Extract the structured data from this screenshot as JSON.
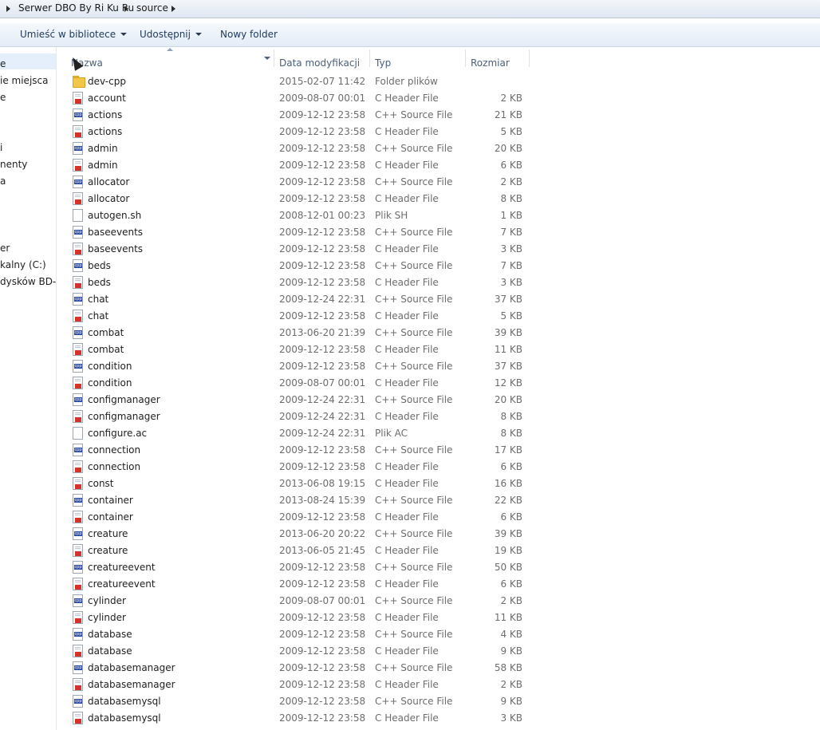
{
  "address": {
    "crumbs": [
      "Serwer DBO By Ri Ku Ru",
      "source"
    ]
  },
  "toolbar": {
    "include_in_library": "Umieść w bibliotece",
    "share": "Udostępnij",
    "new_folder": "Nowy folder"
  },
  "nav": {
    "items": [
      "e",
      "ie miejsca",
      "e",
      "i",
      "nenty",
      "a",
      "er",
      "kalny (C:)",
      "dysków BD-R("
    ]
  },
  "columns": {
    "name": "Nazwa",
    "date": "Data modyfikacji",
    "type": "Typ",
    "size": "Rozmiar"
  },
  "files": [
    {
      "name": "dev-cpp",
      "date": "2015-02-07 11:42",
      "type": "Folder plików",
      "size": "",
      "icon": "folder-icon"
    },
    {
      "name": "account",
      "date": "2009-08-07 00:01",
      "type": "C Header File",
      "size": "2 KB",
      "icon": "c-header-file-icon"
    },
    {
      "name": "actions",
      "date": "2009-12-12 23:58",
      "type": "C++ Source File",
      "size": "21 KB",
      "icon": "cpp-source-file-icon"
    },
    {
      "name": "actions",
      "date": "2009-12-12 23:58",
      "type": "C Header File",
      "size": "5 KB",
      "icon": "c-header-file-icon"
    },
    {
      "name": "admin",
      "date": "2009-12-12 23:58",
      "type": "C++ Source File",
      "size": "20 KB",
      "icon": "cpp-source-file-icon"
    },
    {
      "name": "admin",
      "date": "2009-12-12 23:58",
      "type": "C Header File",
      "size": "6 KB",
      "icon": "c-header-file-icon"
    },
    {
      "name": "allocator",
      "date": "2009-12-12 23:58",
      "type": "C++ Source File",
      "size": "2 KB",
      "icon": "cpp-source-file-icon"
    },
    {
      "name": "allocator",
      "date": "2009-12-12 23:58",
      "type": "C Header File",
      "size": "8 KB",
      "icon": "c-header-file-icon"
    },
    {
      "name": "autogen.sh",
      "date": "2008-12-01 00:23",
      "type": "Plik SH",
      "size": "1 KB",
      "icon": "generic-file-icon"
    },
    {
      "name": "baseevents",
      "date": "2009-12-12 23:58",
      "type": "C++ Source File",
      "size": "7 KB",
      "icon": "cpp-source-file-icon"
    },
    {
      "name": "baseevents",
      "date": "2009-12-12 23:58",
      "type": "C Header File",
      "size": "3 KB",
      "icon": "c-header-file-icon"
    },
    {
      "name": "beds",
      "date": "2009-12-12 23:58",
      "type": "C++ Source File",
      "size": "7 KB",
      "icon": "cpp-source-file-icon"
    },
    {
      "name": "beds",
      "date": "2009-12-12 23:58",
      "type": "C Header File",
      "size": "3 KB",
      "icon": "c-header-file-icon"
    },
    {
      "name": "chat",
      "date": "2009-12-24 22:31",
      "type": "C++ Source File",
      "size": "37 KB",
      "icon": "cpp-source-file-icon"
    },
    {
      "name": "chat",
      "date": "2009-12-12 23:58",
      "type": "C Header File",
      "size": "5 KB",
      "icon": "c-header-file-icon"
    },
    {
      "name": "combat",
      "date": "2013-06-20 21:39",
      "type": "C++ Source File",
      "size": "39 KB",
      "icon": "cpp-source-file-icon"
    },
    {
      "name": "combat",
      "date": "2009-12-12 23:58",
      "type": "C Header File",
      "size": "11 KB",
      "icon": "c-header-file-icon"
    },
    {
      "name": "condition",
      "date": "2009-12-12 23:58",
      "type": "C++ Source File",
      "size": "37 KB",
      "icon": "cpp-source-file-icon"
    },
    {
      "name": "condition",
      "date": "2009-08-07 00:01",
      "type": "C Header File",
      "size": "12 KB",
      "icon": "c-header-file-icon"
    },
    {
      "name": "configmanager",
      "date": "2009-12-24 22:31",
      "type": "C++ Source File",
      "size": "20 KB",
      "icon": "cpp-source-file-icon"
    },
    {
      "name": "configmanager",
      "date": "2009-12-24 22:31",
      "type": "C Header File",
      "size": "8 KB",
      "icon": "c-header-file-icon"
    },
    {
      "name": "configure.ac",
      "date": "2009-12-24 22:31",
      "type": "Plik AC",
      "size": "8 KB",
      "icon": "generic-file-icon"
    },
    {
      "name": "connection",
      "date": "2009-12-12 23:58",
      "type": "C++ Source File",
      "size": "17 KB",
      "icon": "cpp-source-file-icon"
    },
    {
      "name": "connection",
      "date": "2009-12-12 23:58",
      "type": "C Header File",
      "size": "6 KB",
      "icon": "c-header-file-icon"
    },
    {
      "name": "const",
      "date": "2013-06-08 19:15",
      "type": "C Header File",
      "size": "16 KB",
      "icon": "c-header-file-icon"
    },
    {
      "name": "container",
      "date": "2013-08-24 15:39",
      "type": "C++ Source File",
      "size": "22 KB",
      "icon": "cpp-source-file-icon"
    },
    {
      "name": "container",
      "date": "2009-12-12 23:58",
      "type": "C Header File",
      "size": "6 KB",
      "icon": "c-header-file-icon"
    },
    {
      "name": "creature",
      "date": "2013-06-20 20:22",
      "type": "C++ Source File",
      "size": "39 KB",
      "icon": "cpp-source-file-icon"
    },
    {
      "name": "creature",
      "date": "2013-06-05 21:45",
      "type": "C Header File",
      "size": "19 KB",
      "icon": "c-header-file-icon"
    },
    {
      "name": "creatureevent",
      "date": "2009-12-12 23:58",
      "type": "C++ Source File",
      "size": "50 KB",
      "icon": "cpp-source-file-icon"
    },
    {
      "name": "creatureevent",
      "date": "2009-12-12 23:58",
      "type": "C Header File",
      "size": "6 KB",
      "icon": "c-header-file-icon"
    },
    {
      "name": "cylinder",
      "date": "2009-08-07 00:01",
      "type": "C++ Source File",
      "size": "2 KB",
      "icon": "cpp-source-file-icon"
    },
    {
      "name": "cylinder",
      "date": "2009-12-12 23:58",
      "type": "C Header File",
      "size": "11 KB",
      "icon": "c-header-file-icon"
    },
    {
      "name": "database",
      "date": "2009-12-12 23:58",
      "type": "C++ Source File",
      "size": "4 KB",
      "icon": "cpp-source-file-icon"
    },
    {
      "name": "database",
      "date": "2009-12-12 23:58",
      "type": "C Header File",
      "size": "9 KB",
      "icon": "c-header-file-icon"
    },
    {
      "name": "databasemanager",
      "date": "2009-12-12 23:58",
      "type": "C++ Source File",
      "size": "58 KB",
      "icon": "cpp-source-file-icon"
    },
    {
      "name": "databasemanager",
      "date": "2009-12-12 23:58",
      "type": "C Header File",
      "size": "2 KB",
      "icon": "c-header-file-icon"
    },
    {
      "name": "databasemysql",
      "date": "2009-12-12 23:58",
      "type": "C++ Source File",
      "size": "9 KB",
      "icon": "cpp-source-file-icon"
    },
    {
      "name": "databasemysql",
      "date": "2009-12-12 23:58",
      "type": "C Header File",
      "size": "3 KB",
      "icon": "c-header-file-icon"
    }
  ]
}
